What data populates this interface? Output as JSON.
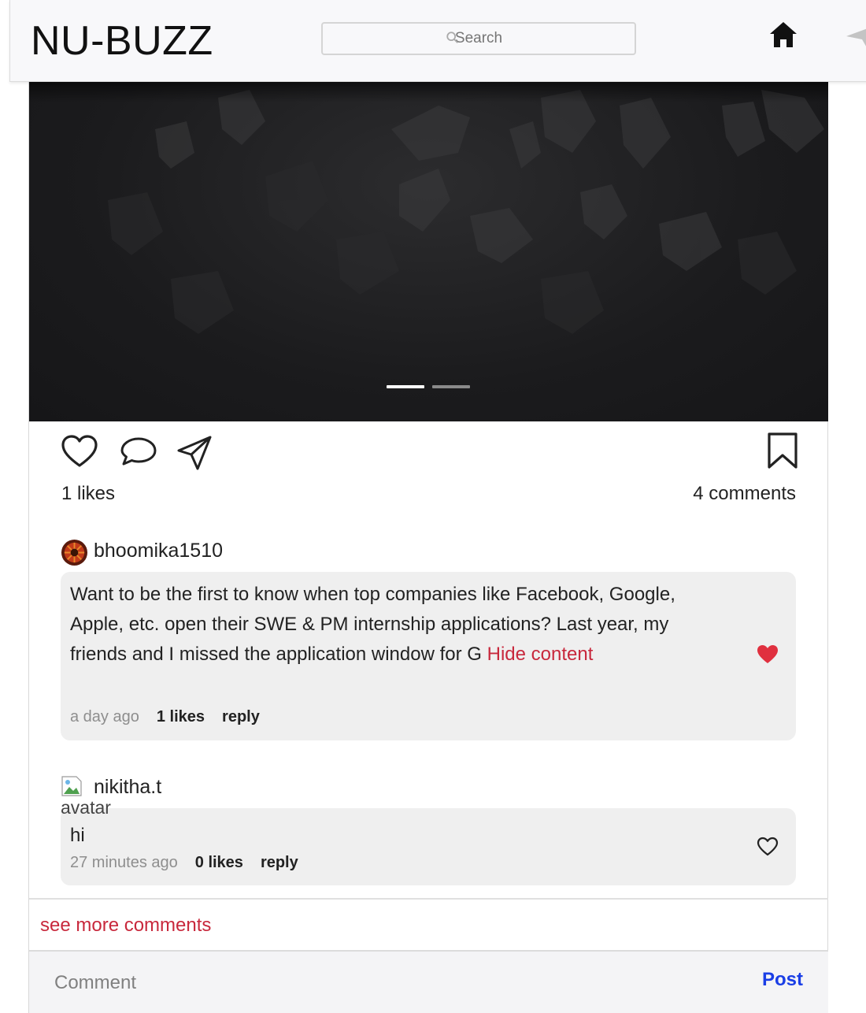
{
  "navbar": {
    "brand": "NU-BUZZ",
    "search_placeholder": "Search",
    "icons": [
      "search-icon",
      "home-icon",
      "send-icon"
    ]
  },
  "post": {
    "carousel": {
      "slides": 2,
      "active_slide": 1
    },
    "actions": {
      "icons": [
        "heart-outline-icon",
        "comment-icon",
        "share-icon",
        "bookmark-icon"
      ]
    },
    "likes_label": "1 likes",
    "comments_label": "4 comments",
    "comments": [
      {
        "username": "bhoomika1510",
        "text": "Want to be the first to know when top companies like Facebook, Google, Apple, etc. open their SWE & PM internship applications? Last year, my friends and I missed the application window for G ",
        "toggle_label": "Hide content",
        "time": "a day ago",
        "likes": "1 likes",
        "reply": "reply",
        "liked": true
      },
      {
        "username": "nikitha.t",
        "avatar_alt": "avatar",
        "text": "hi",
        "time": "27 minutes ago",
        "likes": "0 likes",
        "reply": "reply",
        "liked": false
      }
    ],
    "see_more_label": "see more comments",
    "comment_box": {
      "placeholder": "Comment",
      "post_label": "Post"
    }
  },
  "colors": {
    "accent_red": "#c8283c",
    "post_blue": "#1a3ee6",
    "like_red": "#e0303f"
  }
}
